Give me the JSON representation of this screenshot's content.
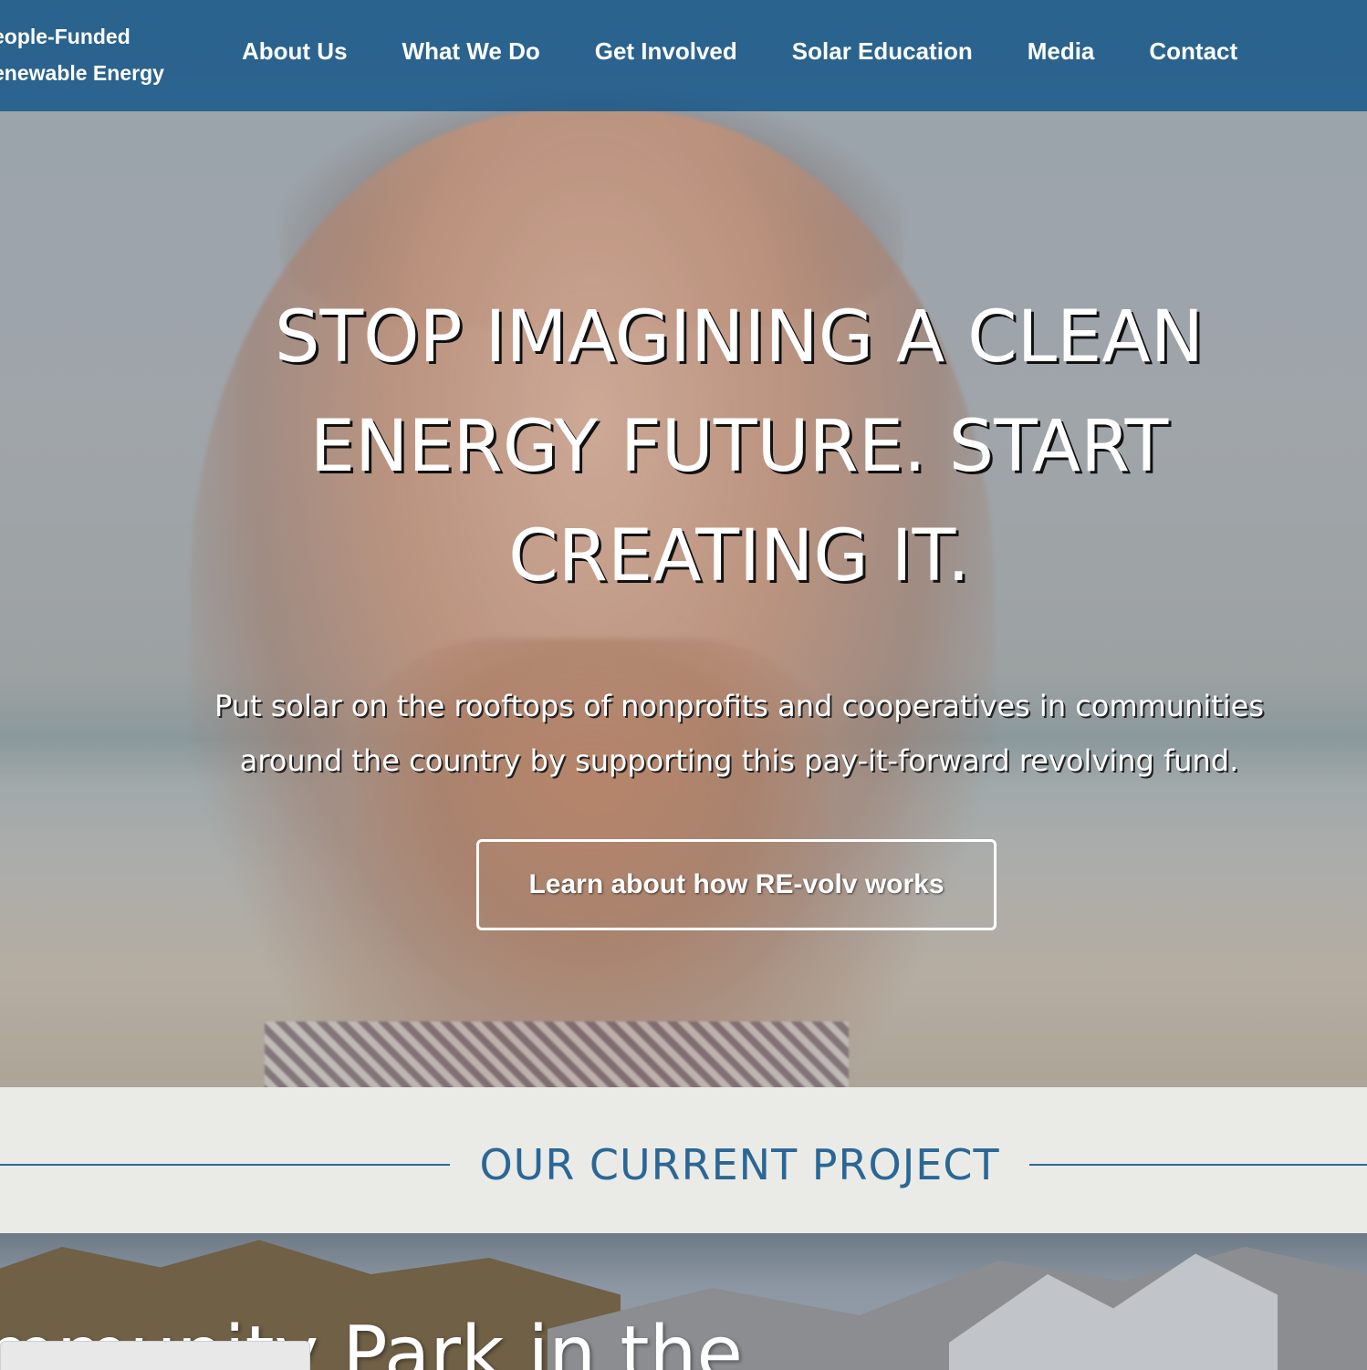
{
  "header": {
    "logo_line1": "eople-Funded",
    "logo_line2": "enewable Energy",
    "nav": [
      {
        "label": "About Us"
      },
      {
        "label": "What We Do"
      },
      {
        "label": "Get Involved"
      },
      {
        "label": "Solar Education"
      },
      {
        "label": "Media"
      },
      {
        "label": "Contact"
      }
    ]
  },
  "hero": {
    "title_line1": "STOP IMAGINING A CLEAN",
    "title_line2": "ENERGY FUTURE. START",
    "title_line3": "CREATING IT.",
    "subtitle_line1": "Put solar on the rooftops of nonprofits and cooperatives in communities",
    "subtitle_line2": "around the country by supporting this pay-it-forward revolving fund.",
    "button_label": "Learn about how RE-volv works"
  },
  "section": {
    "title": "OUR CURRENT PROJECT"
  },
  "project": {
    "heading": "mmunity Park in the"
  },
  "colors": {
    "nav_bg": "#125687",
    "section_bg": "#eaebe7",
    "accent": "#2b6796"
  }
}
